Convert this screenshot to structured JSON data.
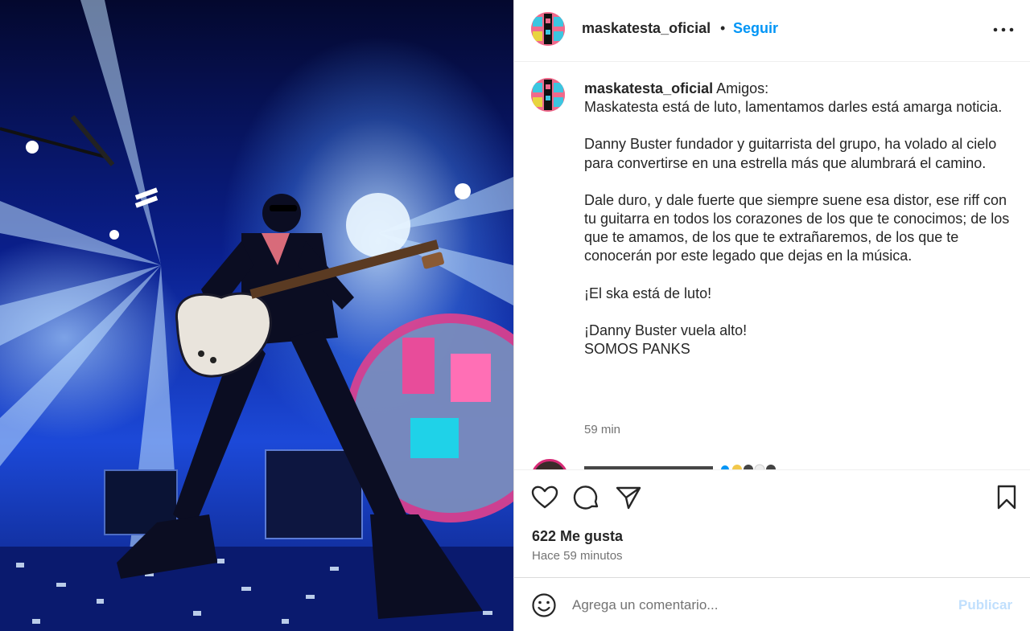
{
  "post": {
    "username": "maskatesta_oficial",
    "separator": "•",
    "follow_label": "Seguir",
    "more_label": "Más opciones"
  },
  "caption": {
    "username": "maskatesta_oficial",
    "paragraphs": [
      "Amigos:\nMaskatesta está de luto, lamentamos darles está amarga noticia.",
      "Danny Buster fundador y guitarrista del grupo, ha volado al cielo para convertirse en una estrella más que alumbrará el camino.",
      "Dale duro, y dale fuerte que siempre suene esa distor, ese riff con tu guitarra en todos los corazones de los que te conocimos; de los que te amamos, de los que te extrañaremos, de los que te conocerán por este legado que dejas en la música.",
      "¡El ska está de luto!",
      "¡Danny Buster vuela alto!\nSOMOS PANKS"
    ],
    "time": "59 min"
  },
  "actions": {
    "likes": "622 Me gusta",
    "time_ago": "Hace 59 minutos"
  },
  "comment_box": {
    "placeholder": "Agrega un comentario...",
    "publish_label": "Publicar"
  },
  "colors": {
    "link_blue": "#0095f6",
    "publish_disabled": "#c0dffd",
    "secondary_text": "#737373"
  },
  "icons": {
    "like": "heart-outline-icon",
    "comment": "speech-bubble-icon",
    "share": "paper-plane-icon",
    "save": "bookmark-icon",
    "emoji": "smiley-icon",
    "more": "three-dots-icon"
  }
}
